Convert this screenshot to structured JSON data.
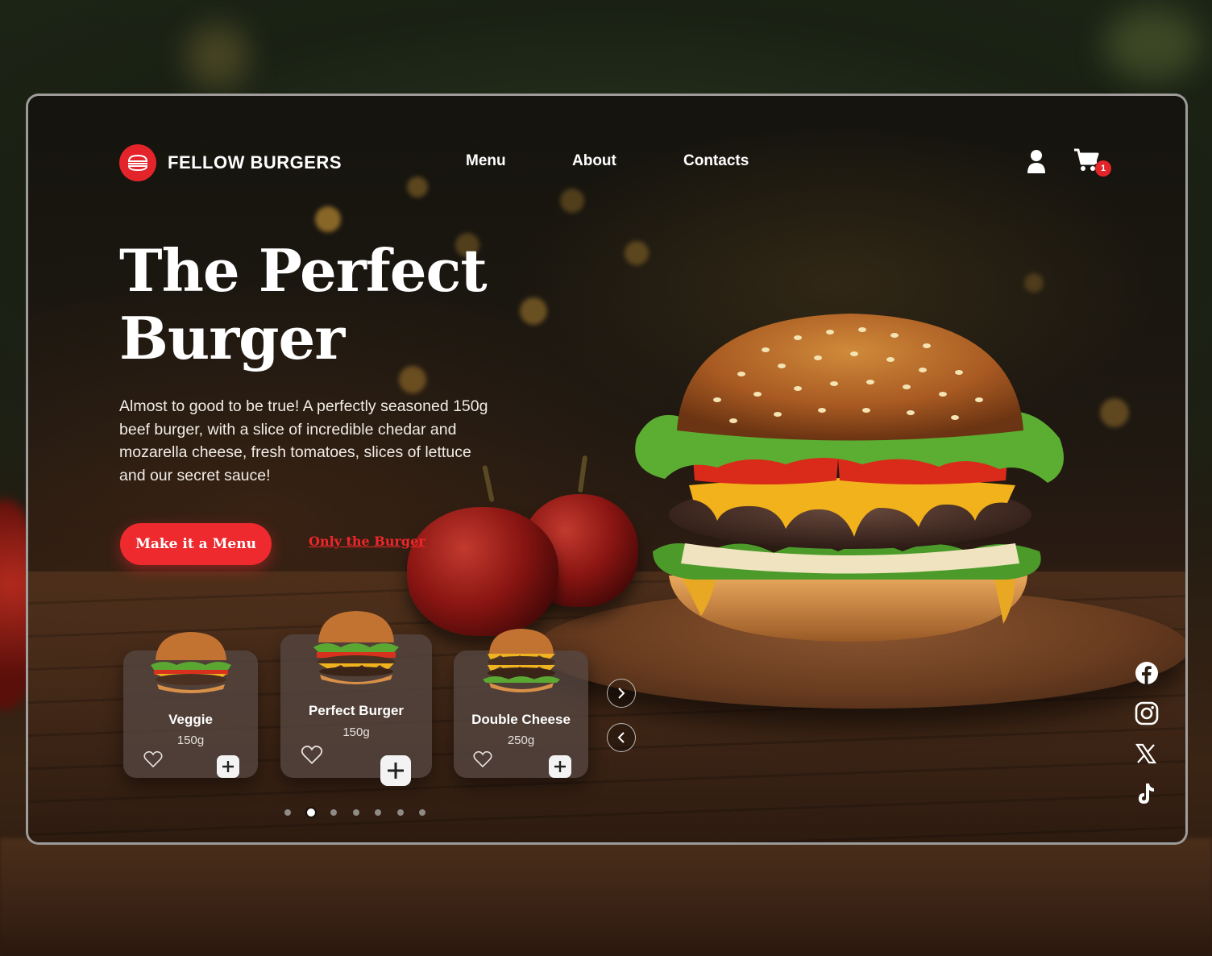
{
  "brand": {
    "name": "FELLOW BURGERS",
    "accent": "#ee2a2f"
  },
  "nav": {
    "items": [
      "Menu",
      "About",
      "Contacts"
    ]
  },
  "header": {
    "user_icon": "user-icon",
    "cart_icon": "cart-icon",
    "cart_count": "1"
  },
  "hero": {
    "title_line1": "The Perfect",
    "title_line2": "Burger",
    "description": "Almost to good to be true! A perfectly seasoned 150g beef burger, with a slice of incredible chedar and mozarella cheese, fresh tomatoes, slices of lettuce and our secret sauce!",
    "primary_cta": "Make it a Menu",
    "secondary_cta": "Only the Burger"
  },
  "products": [
    {
      "name": "Veggie",
      "weight": "150g"
    },
    {
      "name": "Perfect Burger",
      "weight": "150g",
      "active": true
    },
    {
      "name": "Double Cheese",
      "weight": "250g"
    }
  ],
  "carousel": {
    "pages": 7,
    "active_page": 2,
    "next_icon": "chevron-right-icon",
    "prev_icon": "chevron-left-icon"
  },
  "social": [
    "facebook-icon",
    "instagram-icon",
    "x-icon",
    "tiktok-icon"
  ]
}
